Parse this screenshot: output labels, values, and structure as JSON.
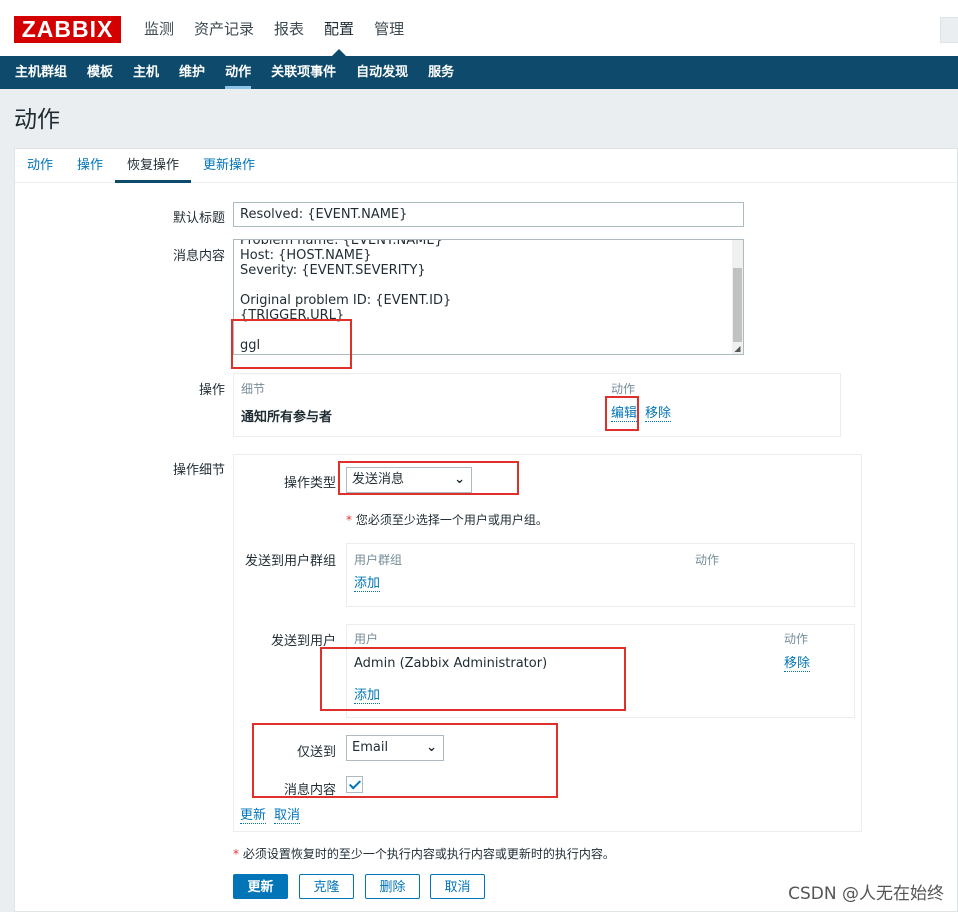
{
  "brand": {
    "logo_text": "ZABBIX",
    "accent": "#d40000",
    "nav_bg": "#0e4a6b",
    "link_color": "#0275b8"
  },
  "main_menu": [
    {
      "label": "监测"
    },
    {
      "label": "资产记录"
    },
    {
      "label": "报表"
    },
    {
      "label": "配置",
      "selected": true
    },
    {
      "label": "管理"
    }
  ],
  "sub_menu": [
    {
      "label": "主机群组"
    },
    {
      "label": "模板"
    },
    {
      "label": "主机"
    },
    {
      "label": "维护"
    },
    {
      "label": "动作",
      "selected": true
    },
    {
      "label": "关联项事件"
    },
    {
      "label": "自动发现"
    },
    {
      "label": "服务"
    }
  ],
  "page_title": "动作",
  "tabs": [
    {
      "label": "动作"
    },
    {
      "label": "操作"
    },
    {
      "label": "恢复操作",
      "active": true
    },
    {
      "label": "更新操作"
    }
  ],
  "form": {
    "default_subject_label": "默认标题",
    "default_subject_value": "Resolved: {EVENT.NAME}",
    "message_label": "消息内容",
    "message_lines": [
      "Problem name: {EVENT.NAME}",
      "Host: {HOST.NAME}",
      "Severity: {EVENT.SEVERITY}",
      "",
      "Original problem ID: {EVENT.ID}",
      "{TRIGGER.URL}",
      "",
      "ggl"
    ],
    "operations_label": "操作",
    "operations_table": {
      "col_details": "细节",
      "col_action": "动作",
      "row_detail": "通知所有参与者",
      "row_edit": "编辑",
      "row_remove": "移除"
    },
    "op_details_label": "操作细节",
    "op_details": {
      "op_type_label": "操作类型",
      "op_type_value": "发送消息",
      "required_note": "您必须至少选择一个用户或用户组。",
      "send_to_groups_label": "发送到用户群组",
      "groups_col_group": "用户群组",
      "groups_col_action": "动作",
      "groups_add": "添加",
      "send_to_users_label": "发送到用户",
      "users_col_user": "用户",
      "users_col_action": "动作",
      "user_row": "Admin (Zabbix Administrator)",
      "user_remove": "移除",
      "users_add": "添加",
      "send_only_to_label": "仅送到",
      "send_only_to_value": "Email",
      "message_content_label": "消息内容",
      "message_content_checked": true,
      "update_link": "更新",
      "cancel_link": "取消"
    },
    "footer_note": "必须设置恢复时的至少一个执行内容或执行内容或更新时的执行内容。",
    "buttons": {
      "update": "更新",
      "clone": "克隆",
      "delete": "删除",
      "cancel": "取消"
    }
  },
  "watermark": "CSDN @人无在始终"
}
